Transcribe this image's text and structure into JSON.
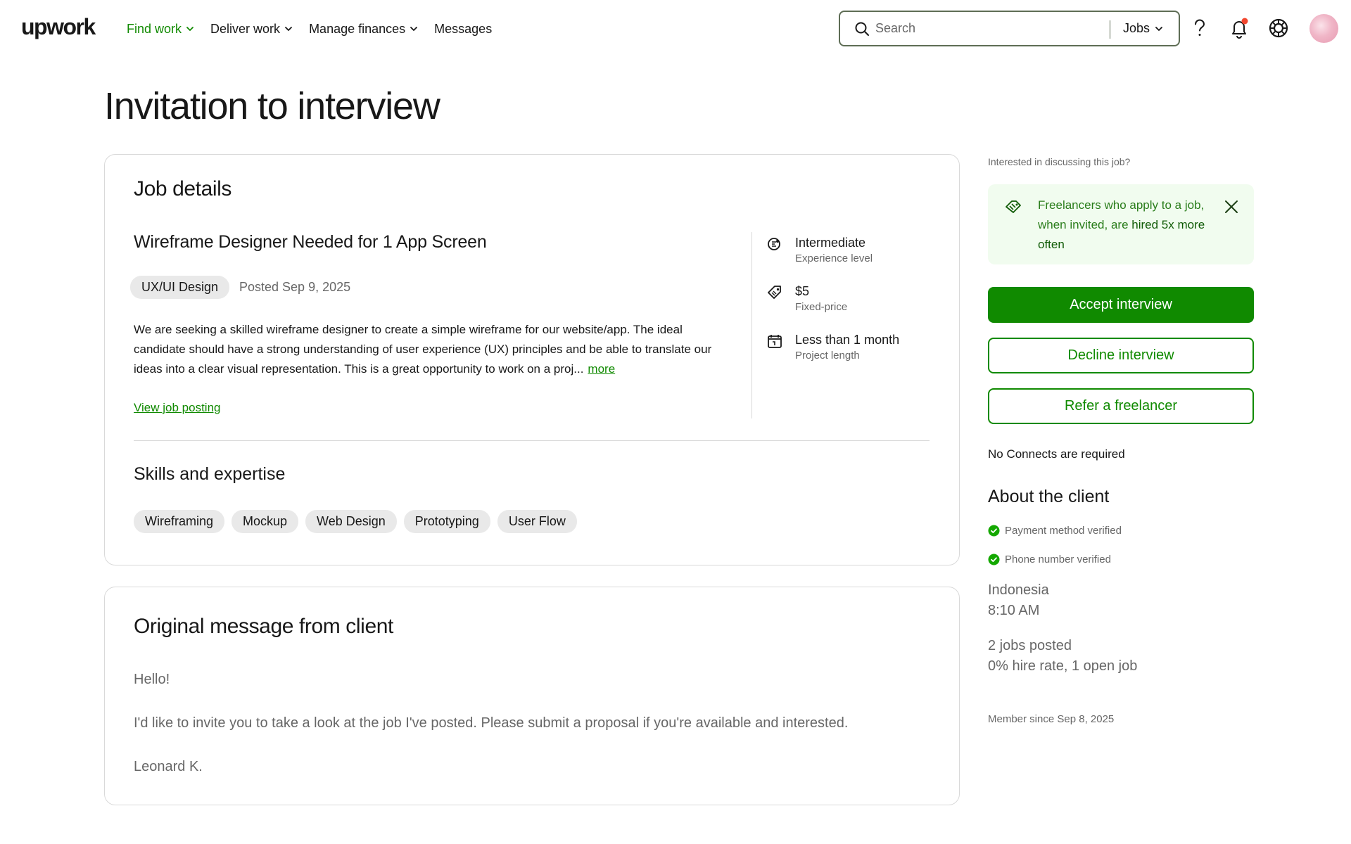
{
  "header": {
    "logo": "upwork",
    "nav": [
      {
        "label": "Find work",
        "has_dropdown": true,
        "active": true
      },
      {
        "label": "Deliver work",
        "has_dropdown": true,
        "active": false
      },
      {
        "label": "Manage finances",
        "has_dropdown": true,
        "active": false
      },
      {
        "label": "Messages",
        "has_dropdown": false,
        "active": false
      }
    ],
    "search": {
      "placeholder": "Search",
      "type_label": "Jobs"
    },
    "icons": [
      "help-icon",
      "bell-icon",
      "account-icon"
    ],
    "notification_dot": true
  },
  "page": {
    "title": "Invitation to interview"
  },
  "job": {
    "section_title": "Job details",
    "title": "Wireframe Designer Needed for 1 App Screen",
    "category": "UX/UI Design",
    "posted": "Posted Sep 9, 2025",
    "description": "We are seeking a skilled wireframe designer to create a simple wireframe for our website/app. The ideal candidate should have a strong understanding of user experience (UX) principles and be able to translate our ideas into a clear visual representation. This is a great opportunity to work on a proj...",
    "more_label": "more",
    "view_posting_label": "View job posting",
    "meta": [
      {
        "icon": "experience-icon",
        "value": "Intermediate",
        "label": "Experience level"
      },
      {
        "icon": "price-tag-icon",
        "value": "$5",
        "label": "Fixed-price"
      },
      {
        "icon": "calendar-icon",
        "value": "Less than 1 month",
        "label": "Project length"
      }
    ],
    "skills_title": "Skills and expertise",
    "skills": [
      "Wireframing",
      "Mockup",
      "Web Design",
      "Prototyping",
      "User Flow"
    ]
  },
  "message": {
    "title": "Original message from client",
    "greeting": "Hello!",
    "body": "I'd like to invite you to take a look at the job I've posted. Please submit a proposal if you're available and interested.",
    "signature": "Leonard K."
  },
  "sidebar": {
    "question": "Interested in discussing this job?",
    "promo": {
      "text_before": "Freelancers who apply to a job, when invited, are ",
      "highlight": "hired 5x more often"
    },
    "accept_label": "Accept interview",
    "decline_label": "Decline interview",
    "refer_label": "Refer a freelancer",
    "connects_note": "No Connects are required",
    "about_title": "About the client",
    "verifications": [
      "Payment method verified",
      "Phone number verified"
    ],
    "country": "Indonesia",
    "local_time": "8:10 AM",
    "jobs_posted": "2 jobs posted",
    "hire_rate": "0% hire rate, 1 open job",
    "member_since": "Member since Sep 8, 2025"
  },
  "colors": {
    "brand_green": "#108a00",
    "promo_bg": "#f1fcef",
    "notification": "#f2472f"
  }
}
